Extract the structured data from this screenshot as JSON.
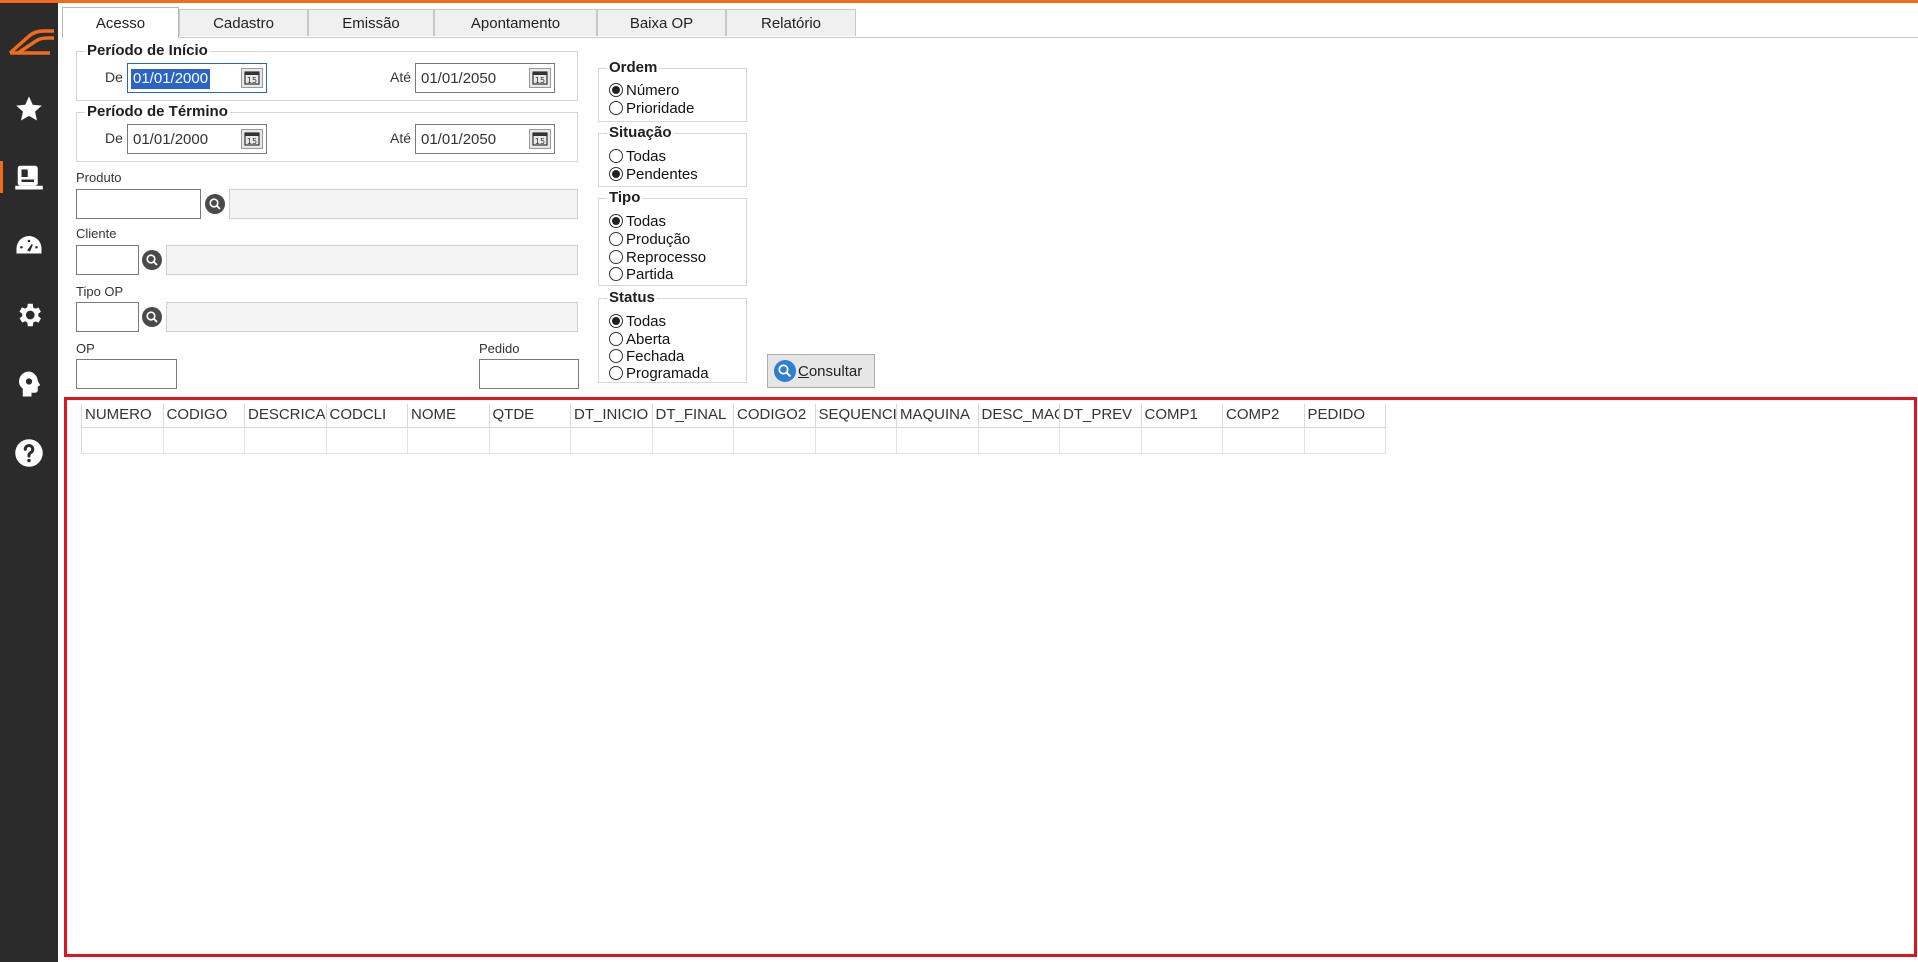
{
  "tabs": [
    {
      "label": "Acesso",
      "active": true
    },
    {
      "label": "Cadastro",
      "active": false
    },
    {
      "label": "Emissão",
      "active": false
    },
    {
      "label": "Apontamento",
      "active": false
    },
    {
      "label": "Baixa OP",
      "active": false
    },
    {
      "label": "Relatório",
      "active": false
    }
  ],
  "sidebar": {
    "items": [
      {
        "icon": "star-icon"
      },
      {
        "icon": "document-icon",
        "active": true
      },
      {
        "icon": "dashboard-icon"
      },
      {
        "icon": "gear-icon"
      },
      {
        "icon": "support-icon"
      },
      {
        "icon": "help-icon"
      }
    ],
    "accent_color": "#f26b1d",
    "background": "#2b2b2b"
  },
  "periodo_inicio": {
    "title": "Período de Início",
    "de_label": "De",
    "de_value": "01/01/2000",
    "ate_label": "Até",
    "ate_value": "01/01/2050"
  },
  "periodo_termino": {
    "title": "Período de Término",
    "de_label": "De",
    "de_value": "01/01/2000",
    "ate_label": "Até",
    "ate_value": "01/01/2050"
  },
  "fields": {
    "produto_label": "Produto",
    "cliente_label": "Cliente",
    "tipo_op_label": "Tipo OP",
    "op_label": "OP",
    "pedido_label": "Pedido"
  },
  "ordem": {
    "title": "Ordem",
    "options": [
      "Número",
      "Prioridade"
    ],
    "selected": "Número"
  },
  "situacao": {
    "title": "Situação",
    "options": [
      "Todas",
      "Pendentes"
    ],
    "selected": "Pendentes"
  },
  "tipo": {
    "title": "Tipo",
    "options": [
      "Todas",
      "Produção",
      "Reprocesso",
      "Partida"
    ],
    "selected": "Todas"
  },
  "status": {
    "title": "Status",
    "options": [
      "Todas",
      "Aberta",
      "Fechada",
      "Programada"
    ],
    "selected": "Todas"
  },
  "consultar": {
    "label_prefix": "",
    "label_underlined": "C",
    "label_rest": "onsultar"
  },
  "grid": {
    "columns": [
      "NUMERO",
      "CODIGO",
      "DESCRICAO",
      "CODCLI",
      "NOME",
      "QTDE",
      "DT_INICIO",
      "DT_FINAL",
      "CODIGO2",
      "SEQUENCIA",
      "MAQUINA",
      "DESC_MAQUINA",
      "DT_PREV",
      "COMP1",
      "COMP2",
      "PEDIDO"
    ],
    "border_color": "#e0141e"
  }
}
